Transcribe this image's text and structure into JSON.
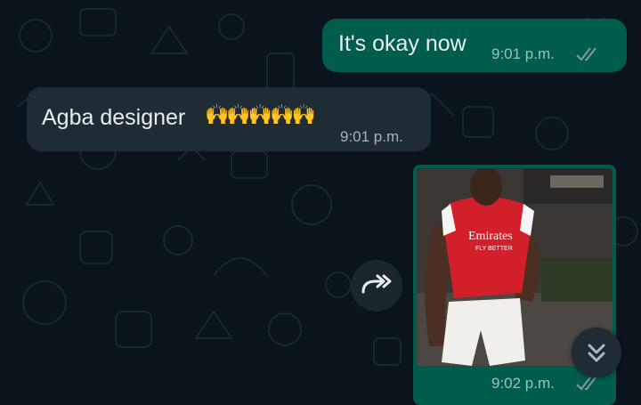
{
  "messages": [
    {
      "direction": "outgoing",
      "text": "It's okay now",
      "time": "9:01 p.m.",
      "status": "read"
    },
    {
      "direction": "incoming",
      "text": "Agba designer",
      "emoji": "🙌🙌🙌🙌🙌",
      "time": "9:01 p.m."
    },
    {
      "direction": "outgoing",
      "type": "image",
      "description": "man in red and white Emirates Fly Better football jersey",
      "time": "9:02 p.m.",
      "status": "read"
    }
  ],
  "image_shirt_text": {
    "line1": "Emirates",
    "line2": "FLY BETTER"
  },
  "icons": {
    "forward": "forward-icon",
    "scroll_down": "double-chevron-down-icon",
    "read_receipt": "double-check-icon"
  },
  "colors": {
    "background": "#0b141a",
    "outgoing_bubble": "#005c4b",
    "incoming_bubble": "#202c33",
    "read_tick": "#53bdeb"
  }
}
